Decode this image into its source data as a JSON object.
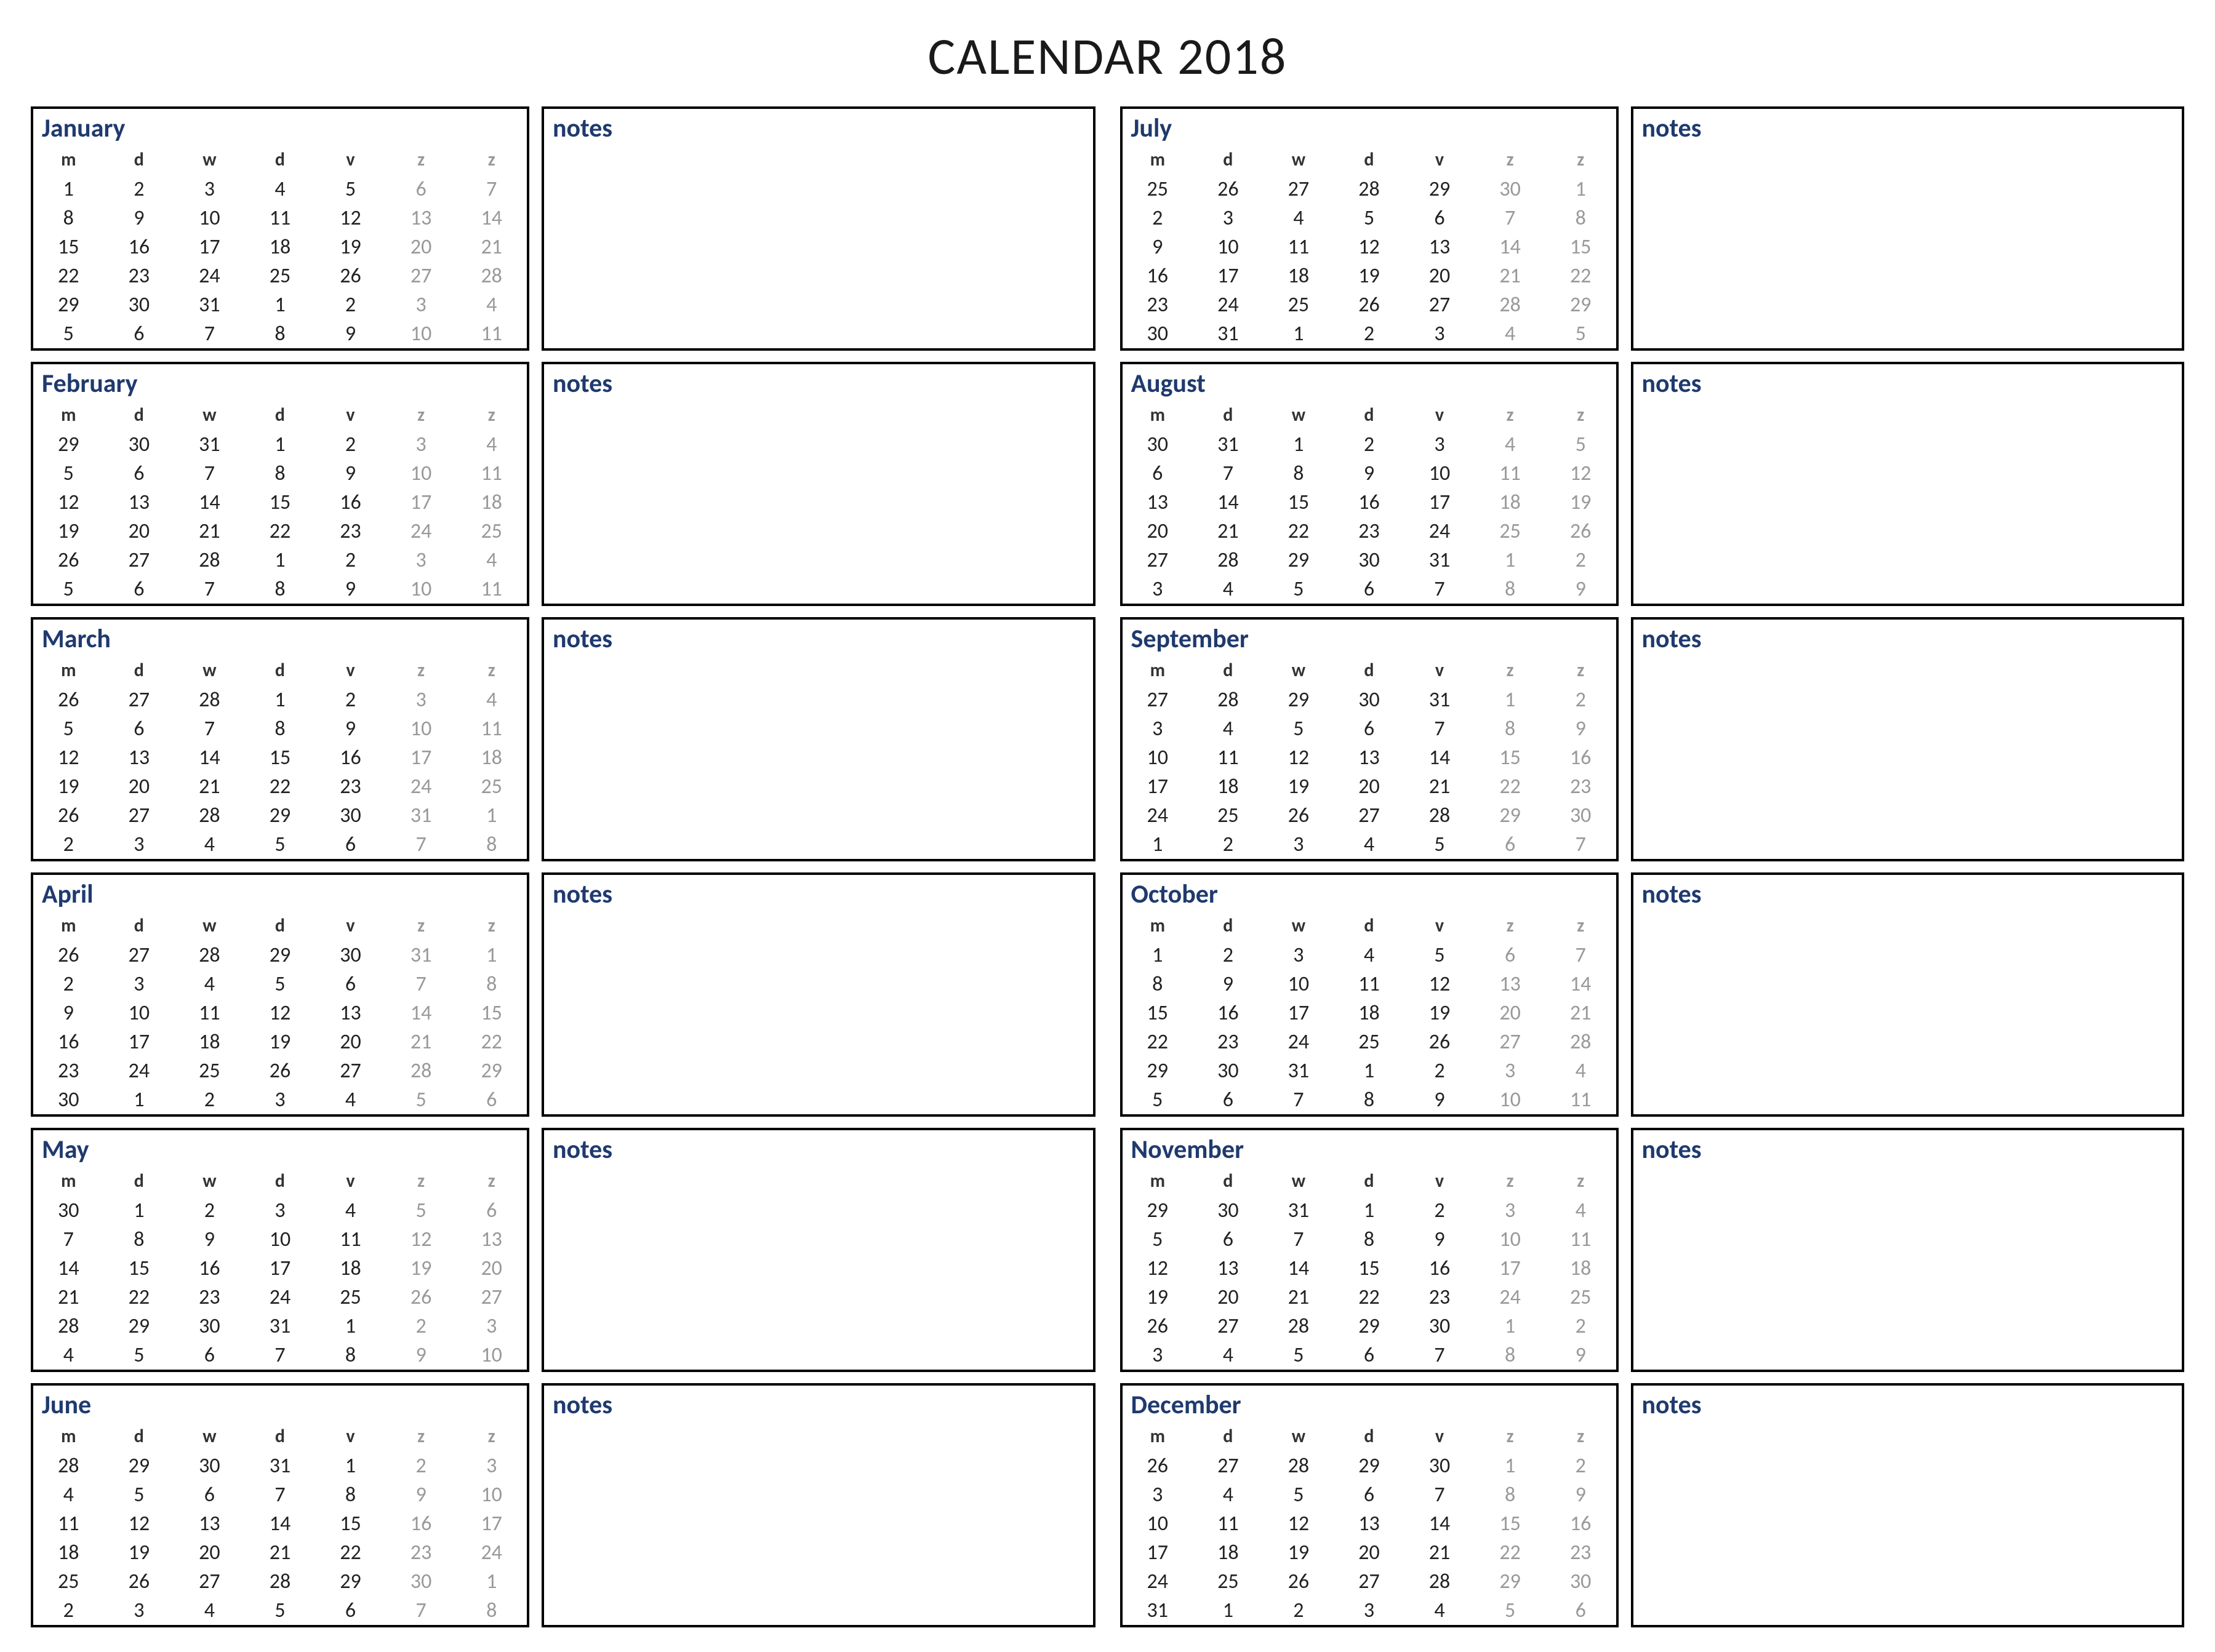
{
  "title": "CALENDAR 2018",
  "notes_label": "notes",
  "day_headers": [
    "m",
    "d",
    "w",
    "d",
    "v",
    "z",
    "z"
  ],
  "months": [
    {
      "name": "January",
      "weeks": [
        [
          1,
          2,
          3,
          4,
          5,
          6,
          7
        ],
        [
          8,
          9,
          10,
          11,
          12,
          13,
          14
        ],
        [
          15,
          16,
          17,
          18,
          19,
          20,
          21
        ],
        [
          22,
          23,
          24,
          25,
          26,
          27,
          28
        ],
        [
          29,
          30,
          31,
          1,
          2,
          3,
          4
        ],
        [
          5,
          6,
          7,
          8,
          9,
          10,
          11
        ]
      ]
    },
    {
      "name": "February",
      "weeks": [
        [
          29,
          30,
          31,
          1,
          2,
          3,
          4
        ],
        [
          5,
          6,
          7,
          8,
          9,
          10,
          11
        ],
        [
          12,
          13,
          14,
          15,
          16,
          17,
          18
        ],
        [
          19,
          20,
          21,
          22,
          23,
          24,
          25
        ],
        [
          26,
          27,
          28,
          1,
          2,
          3,
          4
        ],
        [
          5,
          6,
          7,
          8,
          9,
          10,
          11
        ]
      ]
    },
    {
      "name": "March",
      "weeks": [
        [
          26,
          27,
          28,
          1,
          2,
          3,
          4
        ],
        [
          5,
          6,
          7,
          8,
          9,
          10,
          11
        ],
        [
          12,
          13,
          14,
          15,
          16,
          17,
          18
        ],
        [
          19,
          20,
          21,
          22,
          23,
          24,
          25
        ],
        [
          26,
          27,
          28,
          29,
          30,
          31,
          1
        ],
        [
          2,
          3,
          4,
          5,
          6,
          7,
          8
        ]
      ]
    },
    {
      "name": "April",
      "weeks": [
        [
          26,
          27,
          28,
          29,
          30,
          31,
          1
        ],
        [
          2,
          3,
          4,
          5,
          6,
          7,
          8
        ],
        [
          9,
          10,
          11,
          12,
          13,
          14,
          15
        ],
        [
          16,
          17,
          18,
          19,
          20,
          21,
          22
        ],
        [
          23,
          24,
          25,
          26,
          27,
          28,
          29
        ],
        [
          30,
          1,
          2,
          3,
          4,
          5,
          6
        ]
      ]
    },
    {
      "name": "May",
      "weeks": [
        [
          30,
          1,
          2,
          3,
          4,
          5,
          6
        ],
        [
          7,
          8,
          9,
          10,
          11,
          12,
          13
        ],
        [
          14,
          15,
          16,
          17,
          18,
          19,
          20
        ],
        [
          21,
          22,
          23,
          24,
          25,
          26,
          27
        ],
        [
          28,
          29,
          30,
          31,
          1,
          2,
          3
        ],
        [
          4,
          5,
          6,
          7,
          8,
          9,
          10
        ]
      ]
    },
    {
      "name": "June",
      "weeks": [
        [
          28,
          29,
          30,
          31,
          1,
          2,
          3
        ],
        [
          4,
          5,
          6,
          7,
          8,
          9,
          10
        ],
        [
          11,
          12,
          13,
          14,
          15,
          16,
          17
        ],
        [
          18,
          19,
          20,
          21,
          22,
          23,
          24
        ],
        [
          25,
          26,
          27,
          28,
          29,
          30,
          1
        ],
        [
          2,
          3,
          4,
          5,
          6,
          7,
          8
        ]
      ]
    },
    {
      "name": "July",
      "weeks": [
        [
          25,
          26,
          27,
          28,
          29,
          30,
          1
        ],
        [
          2,
          3,
          4,
          5,
          6,
          7,
          8
        ],
        [
          9,
          10,
          11,
          12,
          13,
          14,
          15
        ],
        [
          16,
          17,
          18,
          19,
          20,
          21,
          22
        ],
        [
          23,
          24,
          25,
          26,
          27,
          28,
          29
        ],
        [
          30,
          31,
          1,
          2,
          3,
          4,
          5
        ]
      ]
    },
    {
      "name": "August",
      "weeks": [
        [
          30,
          31,
          1,
          2,
          3,
          4,
          5
        ],
        [
          6,
          7,
          8,
          9,
          10,
          11,
          12
        ],
        [
          13,
          14,
          15,
          16,
          17,
          18,
          19
        ],
        [
          20,
          21,
          22,
          23,
          24,
          25,
          26
        ],
        [
          27,
          28,
          29,
          30,
          31,
          1,
          2
        ],
        [
          3,
          4,
          5,
          6,
          7,
          8,
          9
        ]
      ]
    },
    {
      "name": "September",
      "weeks": [
        [
          27,
          28,
          29,
          30,
          31,
          1,
          2
        ],
        [
          3,
          4,
          5,
          6,
          7,
          8,
          9
        ],
        [
          10,
          11,
          12,
          13,
          14,
          15,
          16
        ],
        [
          17,
          18,
          19,
          20,
          21,
          22,
          23
        ],
        [
          24,
          25,
          26,
          27,
          28,
          29,
          30
        ],
        [
          1,
          2,
          3,
          4,
          5,
          6,
          7
        ]
      ]
    },
    {
      "name": "October",
      "weeks": [
        [
          1,
          2,
          3,
          4,
          5,
          6,
          7
        ],
        [
          8,
          9,
          10,
          11,
          12,
          13,
          14
        ],
        [
          15,
          16,
          17,
          18,
          19,
          20,
          21
        ],
        [
          22,
          23,
          24,
          25,
          26,
          27,
          28
        ],
        [
          29,
          30,
          31,
          1,
          2,
          3,
          4
        ],
        [
          5,
          6,
          7,
          8,
          9,
          10,
          11
        ]
      ]
    },
    {
      "name": "November",
      "weeks": [
        [
          29,
          30,
          31,
          1,
          2,
          3,
          4
        ],
        [
          5,
          6,
          7,
          8,
          9,
          10,
          11
        ],
        [
          12,
          13,
          14,
          15,
          16,
          17,
          18
        ],
        [
          19,
          20,
          21,
          22,
          23,
          24,
          25
        ],
        [
          26,
          27,
          28,
          29,
          30,
          1,
          2
        ],
        [
          3,
          4,
          5,
          6,
          7,
          8,
          9
        ]
      ]
    },
    {
      "name": "December",
      "weeks": [
        [
          26,
          27,
          28,
          29,
          30,
          1,
          2
        ],
        [
          3,
          4,
          5,
          6,
          7,
          8,
          9
        ],
        [
          10,
          11,
          12,
          13,
          14,
          15,
          16
        ],
        [
          17,
          18,
          19,
          20,
          21,
          22,
          23
        ],
        [
          24,
          25,
          26,
          27,
          28,
          29,
          30
        ],
        [
          31,
          1,
          2,
          3,
          4,
          5,
          6
        ]
      ]
    }
  ]
}
